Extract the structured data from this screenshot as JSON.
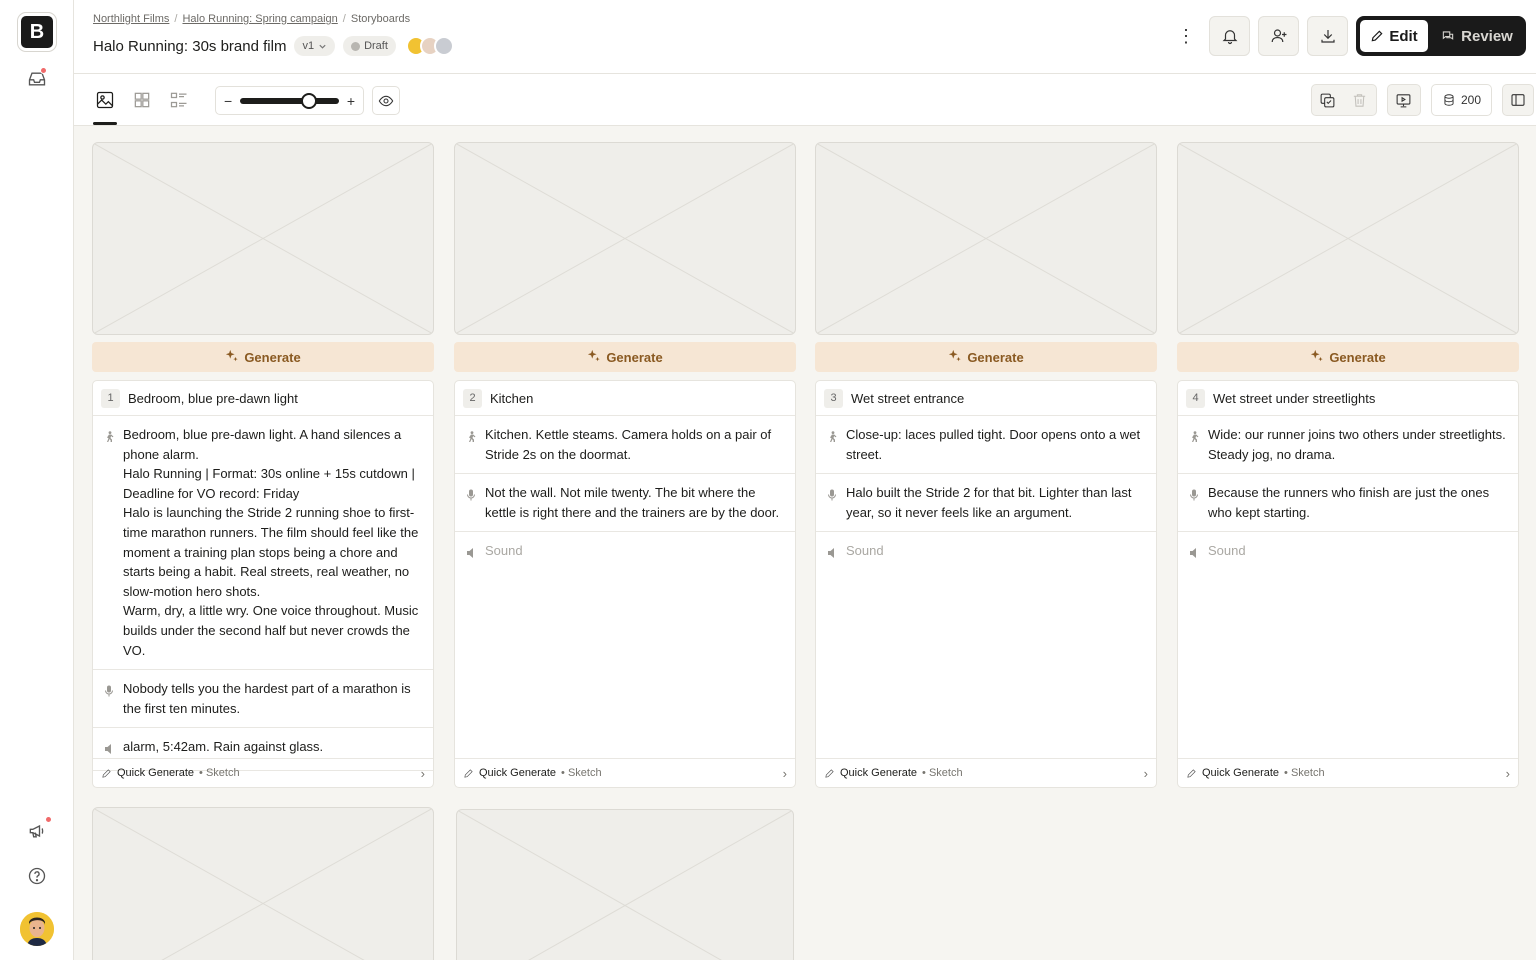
{
  "app": {
    "logo_letter": "B",
    "brand_color": "#1a1a1a"
  },
  "rail": {
    "items": [
      {
        "name": "inbox-icon"
      },
      {
        "name": "megaphone-icon"
      },
      {
        "name": "help-icon"
      }
    ]
  },
  "breadcrumb": [
    "Northlight Films",
    "Halo Running: Spring campaign",
    "Storyboards"
  ],
  "header": {
    "title": "Halo Running: 30s brand film",
    "version": "v1",
    "status": "Draft"
  },
  "mode": {
    "edit": "Edit",
    "review": "Review",
    "active": "Edit"
  },
  "toolbar": {
    "zoom_level_fraction": 0.7,
    "zoom_minus": "−",
    "zoom_plus": "+",
    "credits": "200"
  },
  "generate_label": "Generate",
  "footer": {
    "quick": "Quick Generate",
    "style": "• Sketch"
  },
  "colors": {
    "generate_bg": "#f6e6d4",
    "generate_text": "#8a5a22",
    "accent_dot": "#f06a6a"
  },
  "scenes": [
    {
      "number": "1",
      "name": "Bedroom, blue pre-dawn light",
      "action": "Bedroom, blue pre-dawn light. A hand silences a phone alarm.\nHalo Running | Format: 30s online + 15s cutdown | Deadline for VO record: Friday\nHalo is launching the Stride 2 running shoe to first-time marathon runners. The film should feel like the moment a training plan stops being a chore and starts being a habit. Real streets, real weather, no slow-motion hero shots.\nWarm, dry, a little wry. One voice throughout. Music builds under the second half but never crowds the VO.",
      "dialogue": "Nobody tells you the hardest part of a marathon is the first ten minutes.",
      "sound": "alarm, 5:42am. Rain against glass.",
      "sound_placeholder": false
    },
    {
      "number": "2",
      "name": "Kitchen",
      "action": "Kitchen. Kettle steams. Camera holds on a pair of Stride 2s on the doormat.",
      "dialogue": "Not the wall. Not mile twenty. The bit where the kettle is right there and the trainers are by the door.",
      "sound": "Sound",
      "sound_placeholder": true
    },
    {
      "number": "3",
      "name": "Wet street entrance",
      "action": "Close-up: laces pulled tight. Door opens onto a wet street.",
      "dialogue": "Halo built the Stride 2 for that bit. Lighter than last year, so it never feels like an argument.",
      "sound": "Sound",
      "sound_placeholder": true
    },
    {
      "number": "4",
      "name": "Wet street under streetlights",
      "action": "Wide: our runner joins two others under streetlights. Steady jog, no drama.",
      "dialogue": "Because the runners who finish are just the ones who kept starting.",
      "sound": "Sound",
      "sound_placeholder": true
    }
  ]
}
